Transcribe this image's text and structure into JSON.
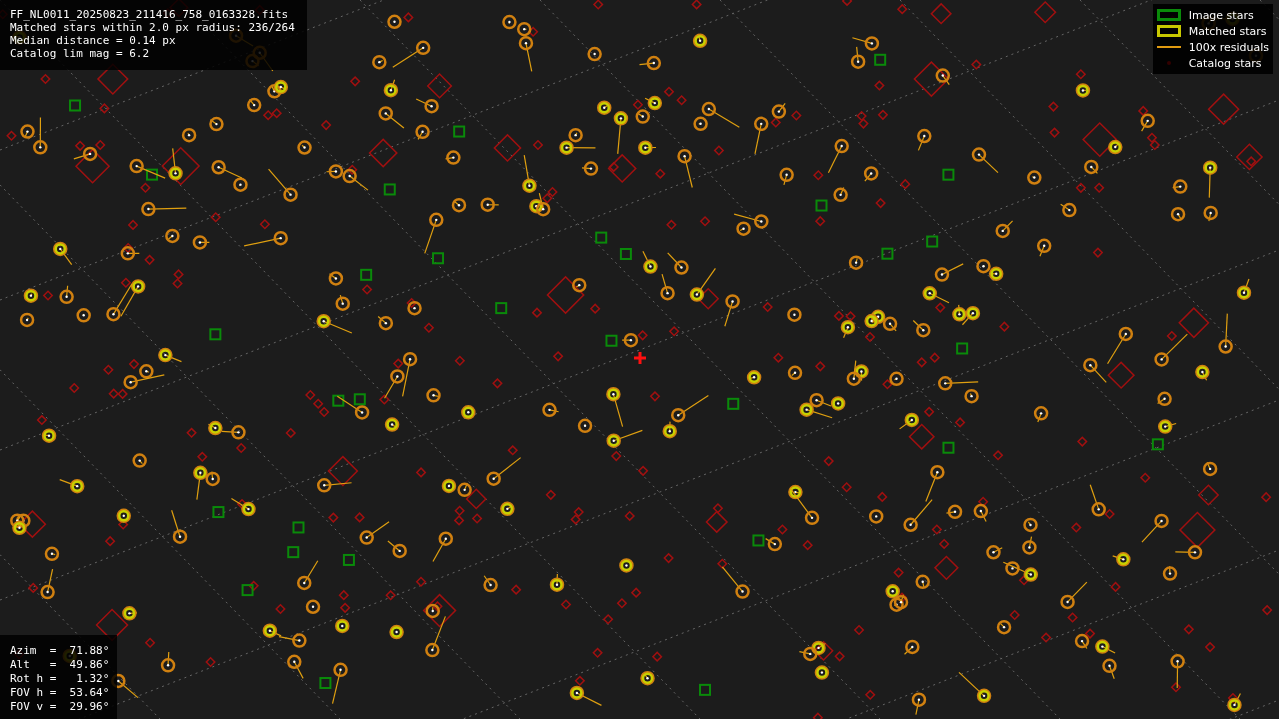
{
  "info_panel": {
    "lines": [
      "FF_NL0011_20250823_211416_758_0163328.fits",
      "Matched stars within 2.0 px radius: 236/264",
      "Median distance = 0.14 px",
      "Catalog lim mag = 6.2"
    ]
  },
  "legend": {
    "items": [
      {
        "kind": "image",
        "label": "Image stars"
      },
      {
        "kind": "matched",
        "label": "Matched stars"
      },
      {
        "kind": "residual",
        "label": "100x residuals"
      },
      {
        "kind": "catalog",
        "label": "Catalog stars"
      }
    ]
  },
  "pointing_panel": {
    "lines": [
      "Azim  =  71.88°",
      "Alt   =  49.86°",
      "Rot h =   1.32°",
      "FOV h =  53.64°",
      "FOV v =  29.96°"
    ]
  }
}
